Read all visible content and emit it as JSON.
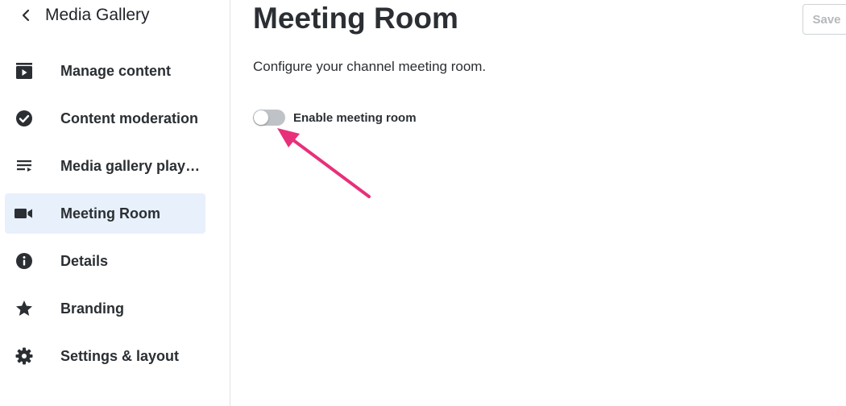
{
  "colors": {
    "accent_arrow": "#e8307a",
    "active_bg": "#e7f0fb",
    "toggle_off": "#bfc3c7"
  },
  "sidebar": {
    "back_icon": "chevron-left-icon",
    "title": "Media Gallery",
    "items": [
      {
        "icon": "video-library-icon",
        "label": "Manage content",
        "active": false
      },
      {
        "icon": "check-circle-icon",
        "label": "Content moderation",
        "active": false
      },
      {
        "icon": "playlist-icon",
        "label": "Media gallery play…",
        "active": false
      },
      {
        "icon": "video-camera-icon",
        "label": "Meeting Room",
        "active": true
      },
      {
        "icon": "info-icon",
        "label": "Details",
        "active": false
      },
      {
        "icon": "star-icon",
        "label": "Branding",
        "active": false
      },
      {
        "icon": "gear-icon",
        "label": "Settings & layout",
        "active": false
      }
    ]
  },
  "main": {
    "title": "Meeting Room",
    "save_label": "Save",
    "description": "Configure your channel meeting room.",
    "toggle": {
      "label": "Enable meeting room",
      "checked": false
    }
  }
}
